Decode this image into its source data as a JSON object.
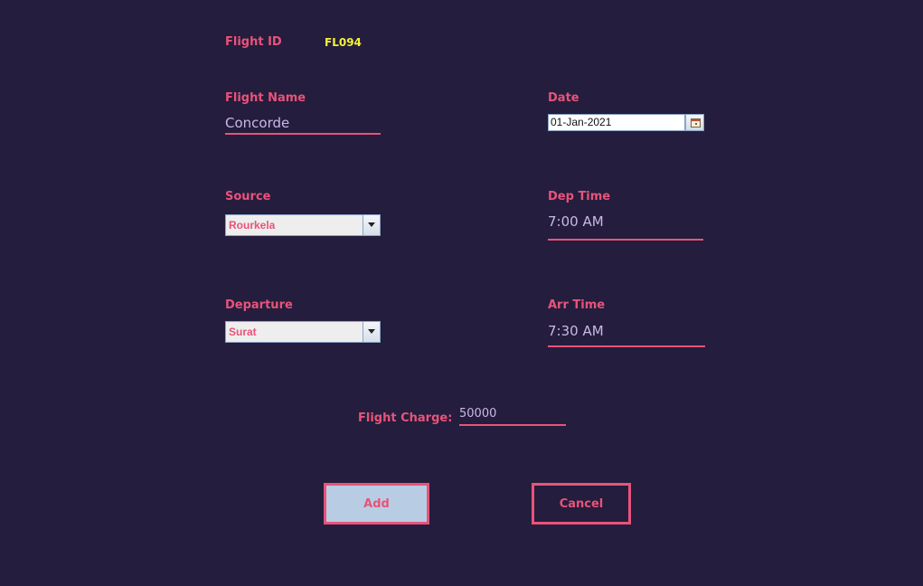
{
  "form": {
    "flight_id_label": "Flight ID",
    "flight_id_value": "FL094",
    "flight_name_label": "Flight Name",
    "flight_name_value": "Concorde",
    "date_label": "Date",
    "date_value": "01-Jan-2021",
    "source_label": "Source",
    "source_value": "Rourkela",
    "dep_time_label": "Dep Time",
    "dep_time_value": "7:00 AM",
    "departure_label": "Departure",
    "departure_value": "Surat",
    "arr_time_label": "Arr Time",
    "arr_time_value": "7:30 AM",
    "flight_charge_label": "Flight Charge:",
    "flight_charge_value": "50000"
  },
  "buttons": {
    "add_label": "Add",
    "cancel_label": "Cancel"
  },
  "colors": {
    "background": "#241d3d",
    "accent": "#e8537a",
    "id_highlight": "#f5f03a",
    "field_text": "#c9b8e8",
    "add_button_fill": "#b8cde4"
  },
  "icons": {
    "combo_arrow": "chevron-down-icon",
    "date_picker": "calendar-icon"
  }
}
